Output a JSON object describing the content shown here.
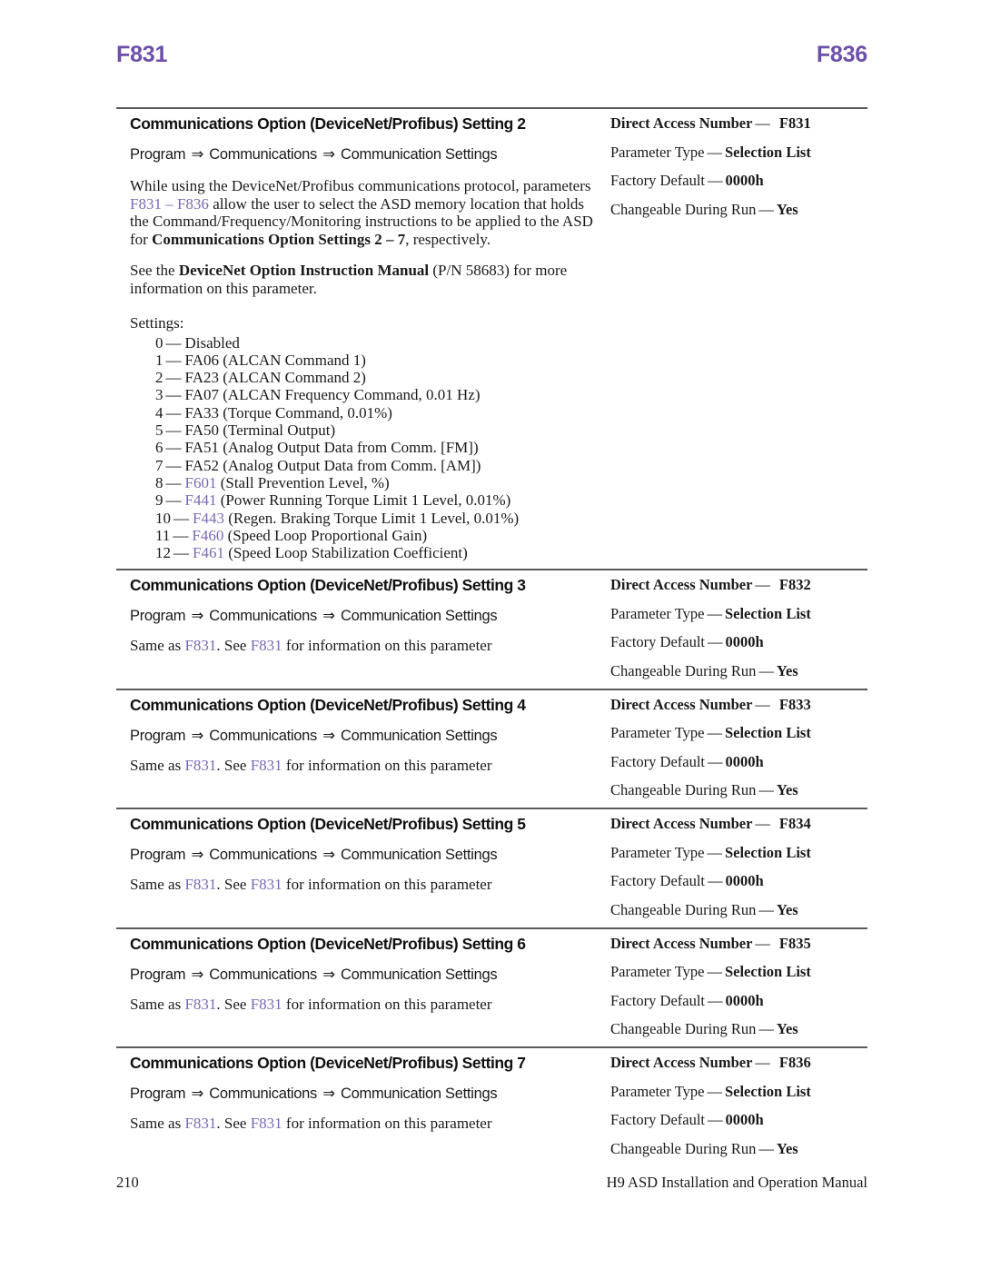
{
  "running_head": {
    "left": "F831",
    "right": "F836",
    "color": "#6b4fa8"
  },
  "colors": {
    "heading_purple": "#6b4fa8",
    "xref_purple": "#7b68b5",
    "rule": "#5a5a5a",
    "text": "#1a1a1a"
  },
  "sections": [
    {
      "title": "Communications Option (DeviceNet/Profibus) Setting 2",
      "nav_path": [
        "Program",
        "Communications",
        "Communication Settings"
      ],
      "paragraphs": [
        {
          "runs": [
            {
              "text": "While using the DeviceNet/Profibus communications protocol, parameters ",
              "style": "normal"
            },
            {
              "text": "F831",
              "style": "xref"
            },
            {
              "text": " – ",
              "style": "xref"
            },
            {
              "text": "F836",
              "style": "xref"
            },
            {
              "text": " allow the user to select the ASD memory location that holds the Command/Frequency/Monitoring instructions to be applied to the ASD for ",
              "style": "normal"
            },
            {
              "text": "Communications Option Settings 2 – 7",
              "style": "bold"
            },
            {
              "text": ", respectively.",
              "style": "normal"
            }
          ]
        },
        {
          "runs": [
            {
              "text": "See the ",
              "style": "normal"
            },
            {
              "text": "DeviceNet Option Instruction Manual",
              "style": "bold"
            },
            {
              "text": " (P/N 58683) for more information on this parameter.",
              "style": "normal"
            }
          ]
        }
      ],
      "settings_label": "Settings:",
      "settings": [
        {
          "num": "0",
          "dash": "—",
          "value": "Disabled",
          "value_style": "normal"
        },
        {
          "num": "1",
          "dash": "—",
          "value": "FA06 (ALCAN Command 1)",
          "value_style": "normal"
        },
        {
          "num": "2",
          "dash": "—",
          "value": "FA23 (ALCAN Command 2)",
          "value_style": "normal"
        },
        {
          "num": "3",
          "dash": "—",
          "value": "FA07 (ALCAN Frequency Command, 0.01 Hz)",
          "value_style": "normal"
        },
        {
          "num": "4",
          "dash": "—",
          "value": "FA33 (Torque Command, 0.01%)",
          "value_style": "normal"
        },
        {
          "num": "5",
          "dash": "—",
          "value": "FA50 (Terminal Output)",
          "value_style": "normal"
        },
        {
          "num": "6",
          "dash": "—",
          "value": "FA51 (Analog Output Data from Comm. [FM])",
          "value_style": "normal"
        },
        {
          "num": "7",
          "dash": "—",
          "value": "FA52 (Analog Output Data from Comm. [AM])",
          "value_style": "normal"
        },
        {
          "num": "8",
          "dash": "—",
          "xref": "F601",
          "value": " (Stall Prevention Level, %)",
          "value_style": "xref-lead"
        },
        {
          "num": "9",
          "dash": "—",
          "xref": "F441",
          "value": " (Power Running Torque Limit 1 Level, 0.01%)",
          "value_style": "xref-lead"
        },
        {
          "num": "10",
          "dash": "—",
          "xref": "F443",
          "value": " (Regen. Braking Torque Limit 1 Level, 0.01%)",
          "value_style": "xref-lead"
        },
        {
          "num": "11",
          "dash": "—",
          "xref": "F460",
          "value": " (Speed Loop Proportional Gain)",
          "value_style": "xref-lead"
        },
        {
          "num": "12",
          "dash": "—",
          "xref": "F461",
          "value": " (Speed Loop Stabilization Coefficient)",
          "value_style": "xref-lead"
        }
      ],
      "spec": {
        "direct_access_label": "Direct Access Number",
        "direct_access_value": "F831",
        "parameter_type_label": "Parameter Type",
        "parameter_type_value": "Selection List",
        "factory_default_label": "Factory Default",
        "factory_default_value": "0000h",
        "changeable_label": "Changeable During Run",
        "changeable_value": "Yes",
        "separator": "—"
      }
    },
    {
      "title": "Communications Option (DeviceNet/Profibus) Setting 3",
      "nav_path": [
        "Program",
        "Communications",
        "Communication Settings"
      ],
      "same_as": {
        "prefix": "Same as ",
        "ref1": "F831",
        "middle": ". See ",
        "ref2": "F831",
        "suffix": " for information on this parameter"
      },
      "spec": {
        "direct_access_label": "Direct Access Number",
        "direct_access_value": "F832",
        "parameter_type_label": "Parameter Type",
        "parameter_type_value": "Selection List",
        "factory_default_label": "Factory Default",
        "factory_default_value": "0000h",
        "changeable_label": "Changeable During Run",
        "changeable_value": "Yes",
        "separator": "—"
      }
    },
    {
      "title": "Communications Option (DeviceNet/Profibus) Setting 4",
      "nav_path": [
        "Program",
        "Communications",
        "Communication Settings"
      ],
      "same_as": {
        "prefix": "Same as ",
        "ref1": "F831",
        "middle": ". See ",
        "ref2": "F831",
        "suffix": " for information on this parameter"
      },
      "spec": {
        "direct_access_label": "Direct Access Number",
        "direct_access_value": "F833",
        "parameter_type_label": "Parameter Type",
        "parameter_type_value": "Selection List",
        "factory_default_label": "Factory Default",
        "factory_default_value": "0000h",
        "changeable_label": "Changeable During Run",
        "changeable_value": "Yes",
        "separator": "—"
      }
    },
    {
      "title": "Communications Option (DeviceNet/Profibus) Setting 5",
      "nav_path": [
        "Program",
        "Communications",
        "Communication Settings"
      ],
      "same_as": {
        "prefix": "Same as ",
        "ref1": "F831",
        "middle": ". See ",
        "ref2": "F831",
        "suffix": " for information on this parameter"
      },
      "spec": {
        "direct_access_label": "Direct Access Number",
        "direct_access_value": "F834",
        "parameter_type_label": "Parameter Type",
        "parameter_type_value": "Selection List",
        "factory_default_label": "Factory Default",
        "factory_default_value": "0000h",
        "changeable_label": "Changeable During Run",
        "changeable_value": "Yes",
        "separator": "—"
      }
    },
    {
      "title": "Communications Option (DeviceNet/Profibus) Setting 6",
      "nav_path": [
        "Program",
        "Communications",
        "Communication Settings"
      ],
      "same_as": {
        "prefix": "Same as ",
        "ref1": "F831",
        "middle": ". See ",
        "ref2": "F831",
        "suffix": " for information on this parameter"
      },
      "spec": {
        "direct_access_label": "Direct Access Number",
        "direct_access_value": "F835",
        "parameter_type_label": "Parameter Type",
        "parameter_type_value": "Selection List",
        "factory_default_label": "Factory Default",
        "factory_default_value": "0000h",
        "changeable_label": "Changeable During Run",
        "changeable_value": "Yes",
        "separator": "—"
      }
    },
    {
      "title": "Communications Option (DeviceNet/Profibus) Setting 7",
      "nav_path": [
        "Program",
        "Communications",
        "Communication Settings"
      ],
      "same_as": {
        "prefix": "Same as ",
        "ref1": "F831",
        "middle": ". See ",
        "ref2": "F831",
        "suffix": " for information on this parameter"
      },
      "spec": {
        "direct_access_label": "Direct Access Number",
        "direct_access_value": "F836",
        "parameter_type_label": "Parameter Type",
        "parameter_type_value": "Selection List",
        "factory_default_label": "Factory Default",
        "factory_default_value": "0000h",
        "changeable_label": "Changeable During Run",
        "changeable_value": "Yes",
        "separator": "—"
      }
    }
  ],
  "footer": {
    "page_number": "210",
    "manual_title": "H9 ASD Installation and Operation Manual"
  },
  "symbols": {
    "nav_arrow": "⇒"
  }
}
